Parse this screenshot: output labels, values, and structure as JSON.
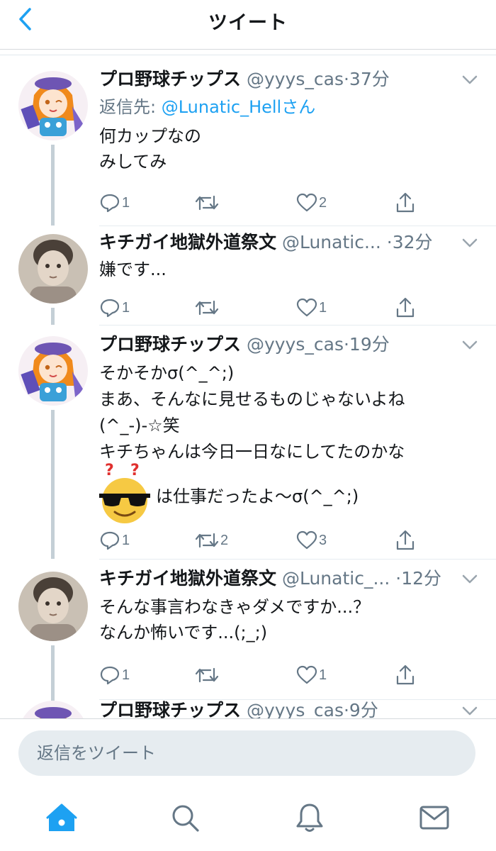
{
  "header": {
    "title": "ツイート",
    "back_icon": "chevron-left-icon"
  },
  "colors": {
    "accent": "#1da1f2",
    "secondary": "#657786",
    "text": "#14171a",
    "thread_line": "#c4cfd6"
  },
  "tweets": [
    {
      "name": "プロ野球チップス",
      "handle": "@yyys_cas",
      "sep": "·",
      "time": "37分",
      "reply_label": "返信先: ",
      "reply_to": "@Lunatic_Hellさん",
      "lines": [
        "何カップなの",
        "みしてみ"
      ],
      "replies": "1",
      "retweets": "",
      "likes": "2"
    },
    {
      "name": "キチガイ地獄外道祭文",
      "handle": "@Lunatic...",
      "sep": "·",
      "time": "32分",
      "lines": [
        "嫌です..."
      ],
      "replies": "1",
      "retweets": "",
      "likes": "1"
    },
    {
      "name": "プロ野球チップス",
      "handle": "@yyys_cas",
      "sep": "·",
      "time": "19分",
      "lines": [
        "そかそかσ(^_^;)",
        "まあ、そんなに見せるものじゃないよね",
        "(^_-)-☆笑",
        "キチちゃんは今日一日なにしてたのかな",
        "は仕事だったよ〜σ(^_^;)"
      ],
      "replies": "1",
      "retweets": "2",
      "likes": "3"
    },
    {
      "name": "キチガイ地獄外道祭文",
      "handle": "@Lunatic_...",
      "sep": "·",
      "time": "12分",
      "lines": [
        "そんな事言わなきゃダメですか...？",
        "なんか怖いです...(;_;)"
      ],
      "replies": "1",
      "retweets": "",
      "likes": "1"
    },
    {
      "name": "プロ野球チップス",
      "handle": "@yyys_cas",
      "sep": "·",
      "time": "9分",
      "lines": []
    }
  ],
  "composer": {
    "placeholder": "返信をツイート"
  },
  "tabs": [
    "home-icon",
    "search-icon",
    "notifications-icon",
    "messages-icon"
  ]
}
